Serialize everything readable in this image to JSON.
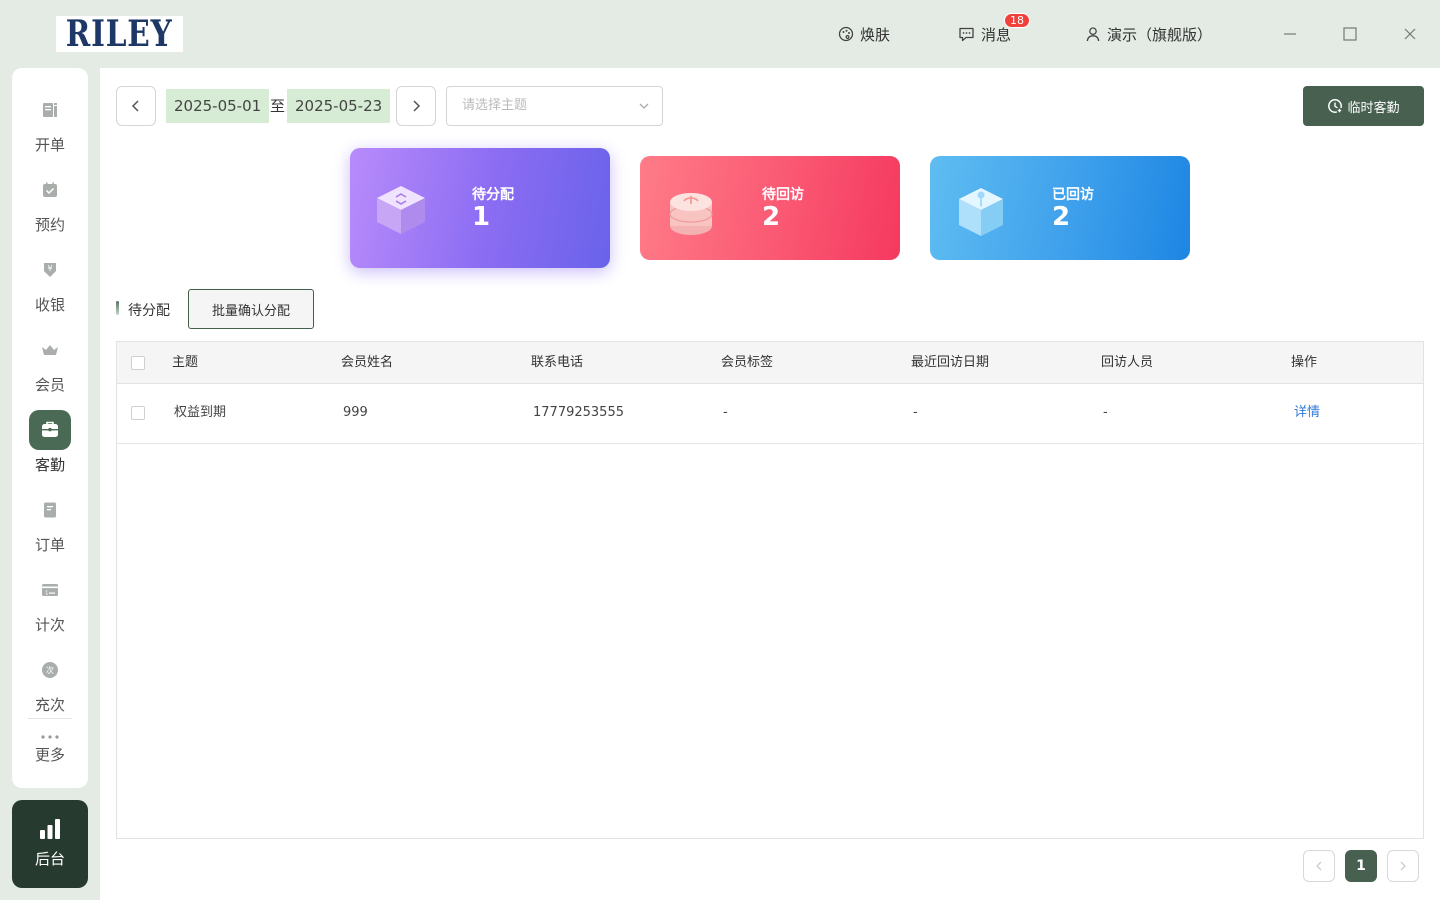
{
  "app": {
    "logo_text": "RILEY",
    "skin_label": "焕肤",
    "messages_label": "消息",
    "messages_count": "18",
    "user_label": "演示（旗舰版）"
  },
  "sidebar": {
    "items": [
      {
        "label": "开单",
        "icon": "receipt-icon"
      },
      {
        "label": "预约",
        "icon": "calendar-check-icon"
      },
      {
        "label": "收银",
        "icon": "cashier-icon"
      },
      {
        "label": "会员",
        "icon": "crown-icon"
      },
      {
        "label": "客勤",
        "icon": "briefcase-icon",
        "active": true
      },
      {
        "label": "订单",
        "icon": "document-icon"
      },
      {
        "label": "计次",
        "icon": "card-icon"
      },
      {
        "label": "充次",
        "icon": "recharge-icon"
      }
    ],
    "more_label": "更多",
    "backend_label": "后台"
  },
  "toolbar": {
    "start_date": "2025-05-01",
    "date_separator": "至",
    "end_date": "2025-05-23",
    "topic_placeholder": "请选择主题",
    "temp_visit_label": "临时客勤"
  },
  "cards": [
    {
      "title": "待分配",
      "value": "1"
    },
    {
      "title": "待回访",
      "value": "2"
    },
    {
      "title": "已回访",
      "value": "2"
    }
  ],
  "section": {
    "title": "待分配",
    "batch_label": "批量确认分配"
  },
  "table": {
    "headers": [
      "主题",
      "会员姓名",
      "联系电话",
      "会员标签",
      "最近回访日期",
      "回访人员",
      "操作"
    ],
    "rows": [
      {
        "topic": "权益到期",
        "name": "999",
        "phone": "17779253555",
        "tag": "-",
        "last_date": "-",
        "staff": "-",
        "action": "详情"
      }
    ]
  },
  "pagination": {
    "current_page": "1"
  },
  "colors": {
    "brand_dark": "#48604f",
    "card_purple": "#8a6cf2",
    "card_red": "#fa5873",
    "card_blue": "#3ea0ec"
  }
}
